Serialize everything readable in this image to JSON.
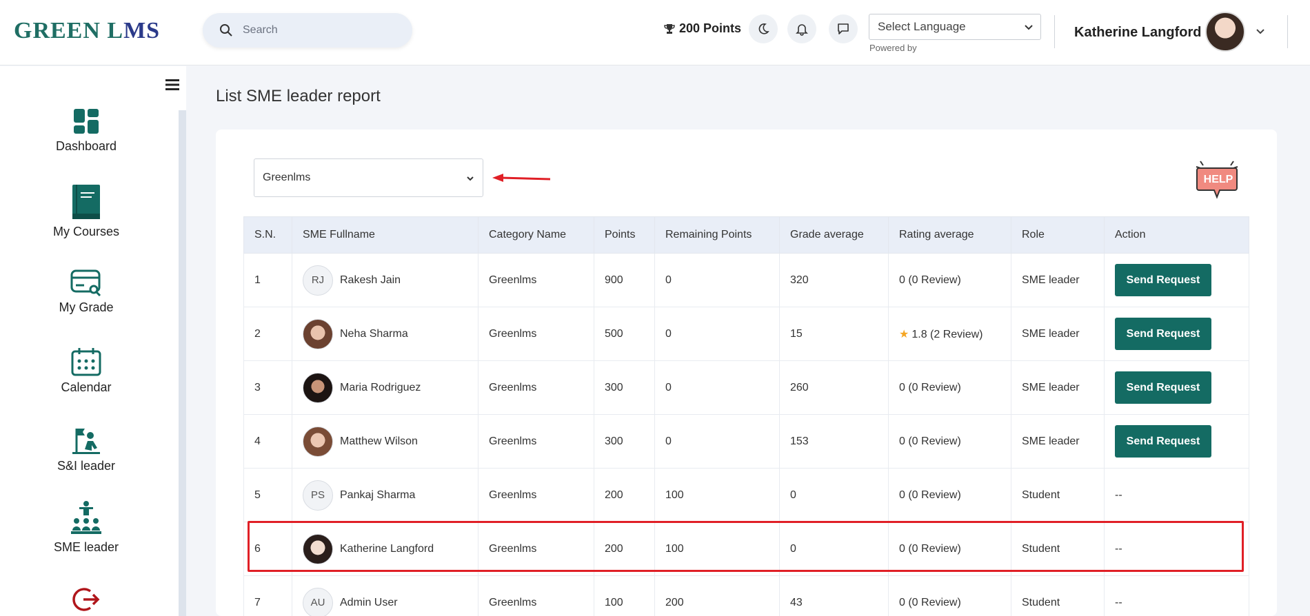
{
  "header": {
    "logo_text_1": "GREEN L",
    "logo_text_2": "MS",
    "search_placeholder": "Search",
    "points": "200 Points",
    "language_select": "Select Language",
    "powered_by": "Powered by",
    "user_name": "Katherine Langford"
  },
  "sidebar": {
    "items": [
      {
        "label": "Dashboard",
        "icon": "dashboard-icon"
      },
      {
        "label": "My Courses",
        "icon": "book-icon"
      },
      {
        "label": "My Grade",
        "icon": "grade-card-icon"
      },
      {
        "label": "Calendar",
        "icon": "calendar-icon"
      },
      {
        "label": "S&I leader",
        "icon": "leader-flag-icon"
      },
      {
        "label": "SME leader",
        "icon": "team-leader-icon"
      },
      {
        "label": "",
        "icon": "logout-icon"
      }
    ]
  },
  "page": {
    "title": "List SME leader report",
    "filter_value": "Greenlms"
  },
  "help": {
    "label": "HELP"
  },
  "table": {
    "headers": [
      "S.N.",
      "SME Fullname",
      "Category Name",
      "Points",
      "Remaining Points",
      "Grade average",
      "Rating average",
      "Role",
      "Action"
    ],
    "rows": [
      {
        "sn": "1",
        "initials": "RJ",
        "name": "Rakesh Jain",
        "category": "Greenlms",
        "points": "900",
        "remaining": "0",
        "grade": "320",
        "rating": "0 (0 Review)",
        "star": false,
        "role": "SME leader",
        "action": "Send Request"
      },
      {
        "sn": "2",
        "initials": "",
        "name": "Neha Sharma",
        "category": "Greenlms",
        "points": "500",
        "remaining": "0",
        "grade": "15",
        "rating": "1.8 (2 Review)",
        "star": true,
        "role": "SME leader",
        "action": "Send Request"
      },
      {
        "sn": "3",
        "initials": "",
        "name": "Maria Rodriguez",
        "category": "Greenlms",
        "points": "300",
        "remaining": "0",
        "grade": "260",
        "rating": "0 (0 Review)",
        "star": false,
        "role": "SME leader",
        "action": "Send Request"
      },
      {
        "sn": "4",
        "initials": "",
        "name": "Matthew Wilson",
        "category": "Greenlms",
        "points": "300",
        "remaining": "0",
        "grade": "153",
        "rating": "0 (0 Review)",
        "star": false,
        "role": "SME leader",
        "action": "Send Request"
      },
      {
        "sn": "5",
        "initials": "PS",
        "name": "Pankaj Sharma",
        "category": "Greenlms",
        "points": "200",
        "remaining": "100",
        "grade": "0",
        "rating": "0 (0 Review)",
        "star": false,
        "role": "Student",
        "action": "--"
      },
      {
        "sn": "6",
        "initials": "",
        "name": "Katherine Langford",
        "category": "Greenlms",
        "points": "200",
        "remaining": "100",
        "grade": "0",
        "rating": "0 (0 Review)",
        "star": false,
        "role": "Student",
        "action": "--"
      },
      {
        "sn": "7",
        "initials": "AU",
        "name": "Admin User",
        "category": "Greenlms",
        "points": "100",
        "remaining": "200",
        "grade": "43",
        "rating": "0 (0 Review)",
        "star": false,
        "role": "Student",
        "action": "--"
      }
    ]
  },
  "colors": {
    "brand": "#146b63",
    "highlight": "#e01f26",
    "star": "#f5a623"
  }
}
